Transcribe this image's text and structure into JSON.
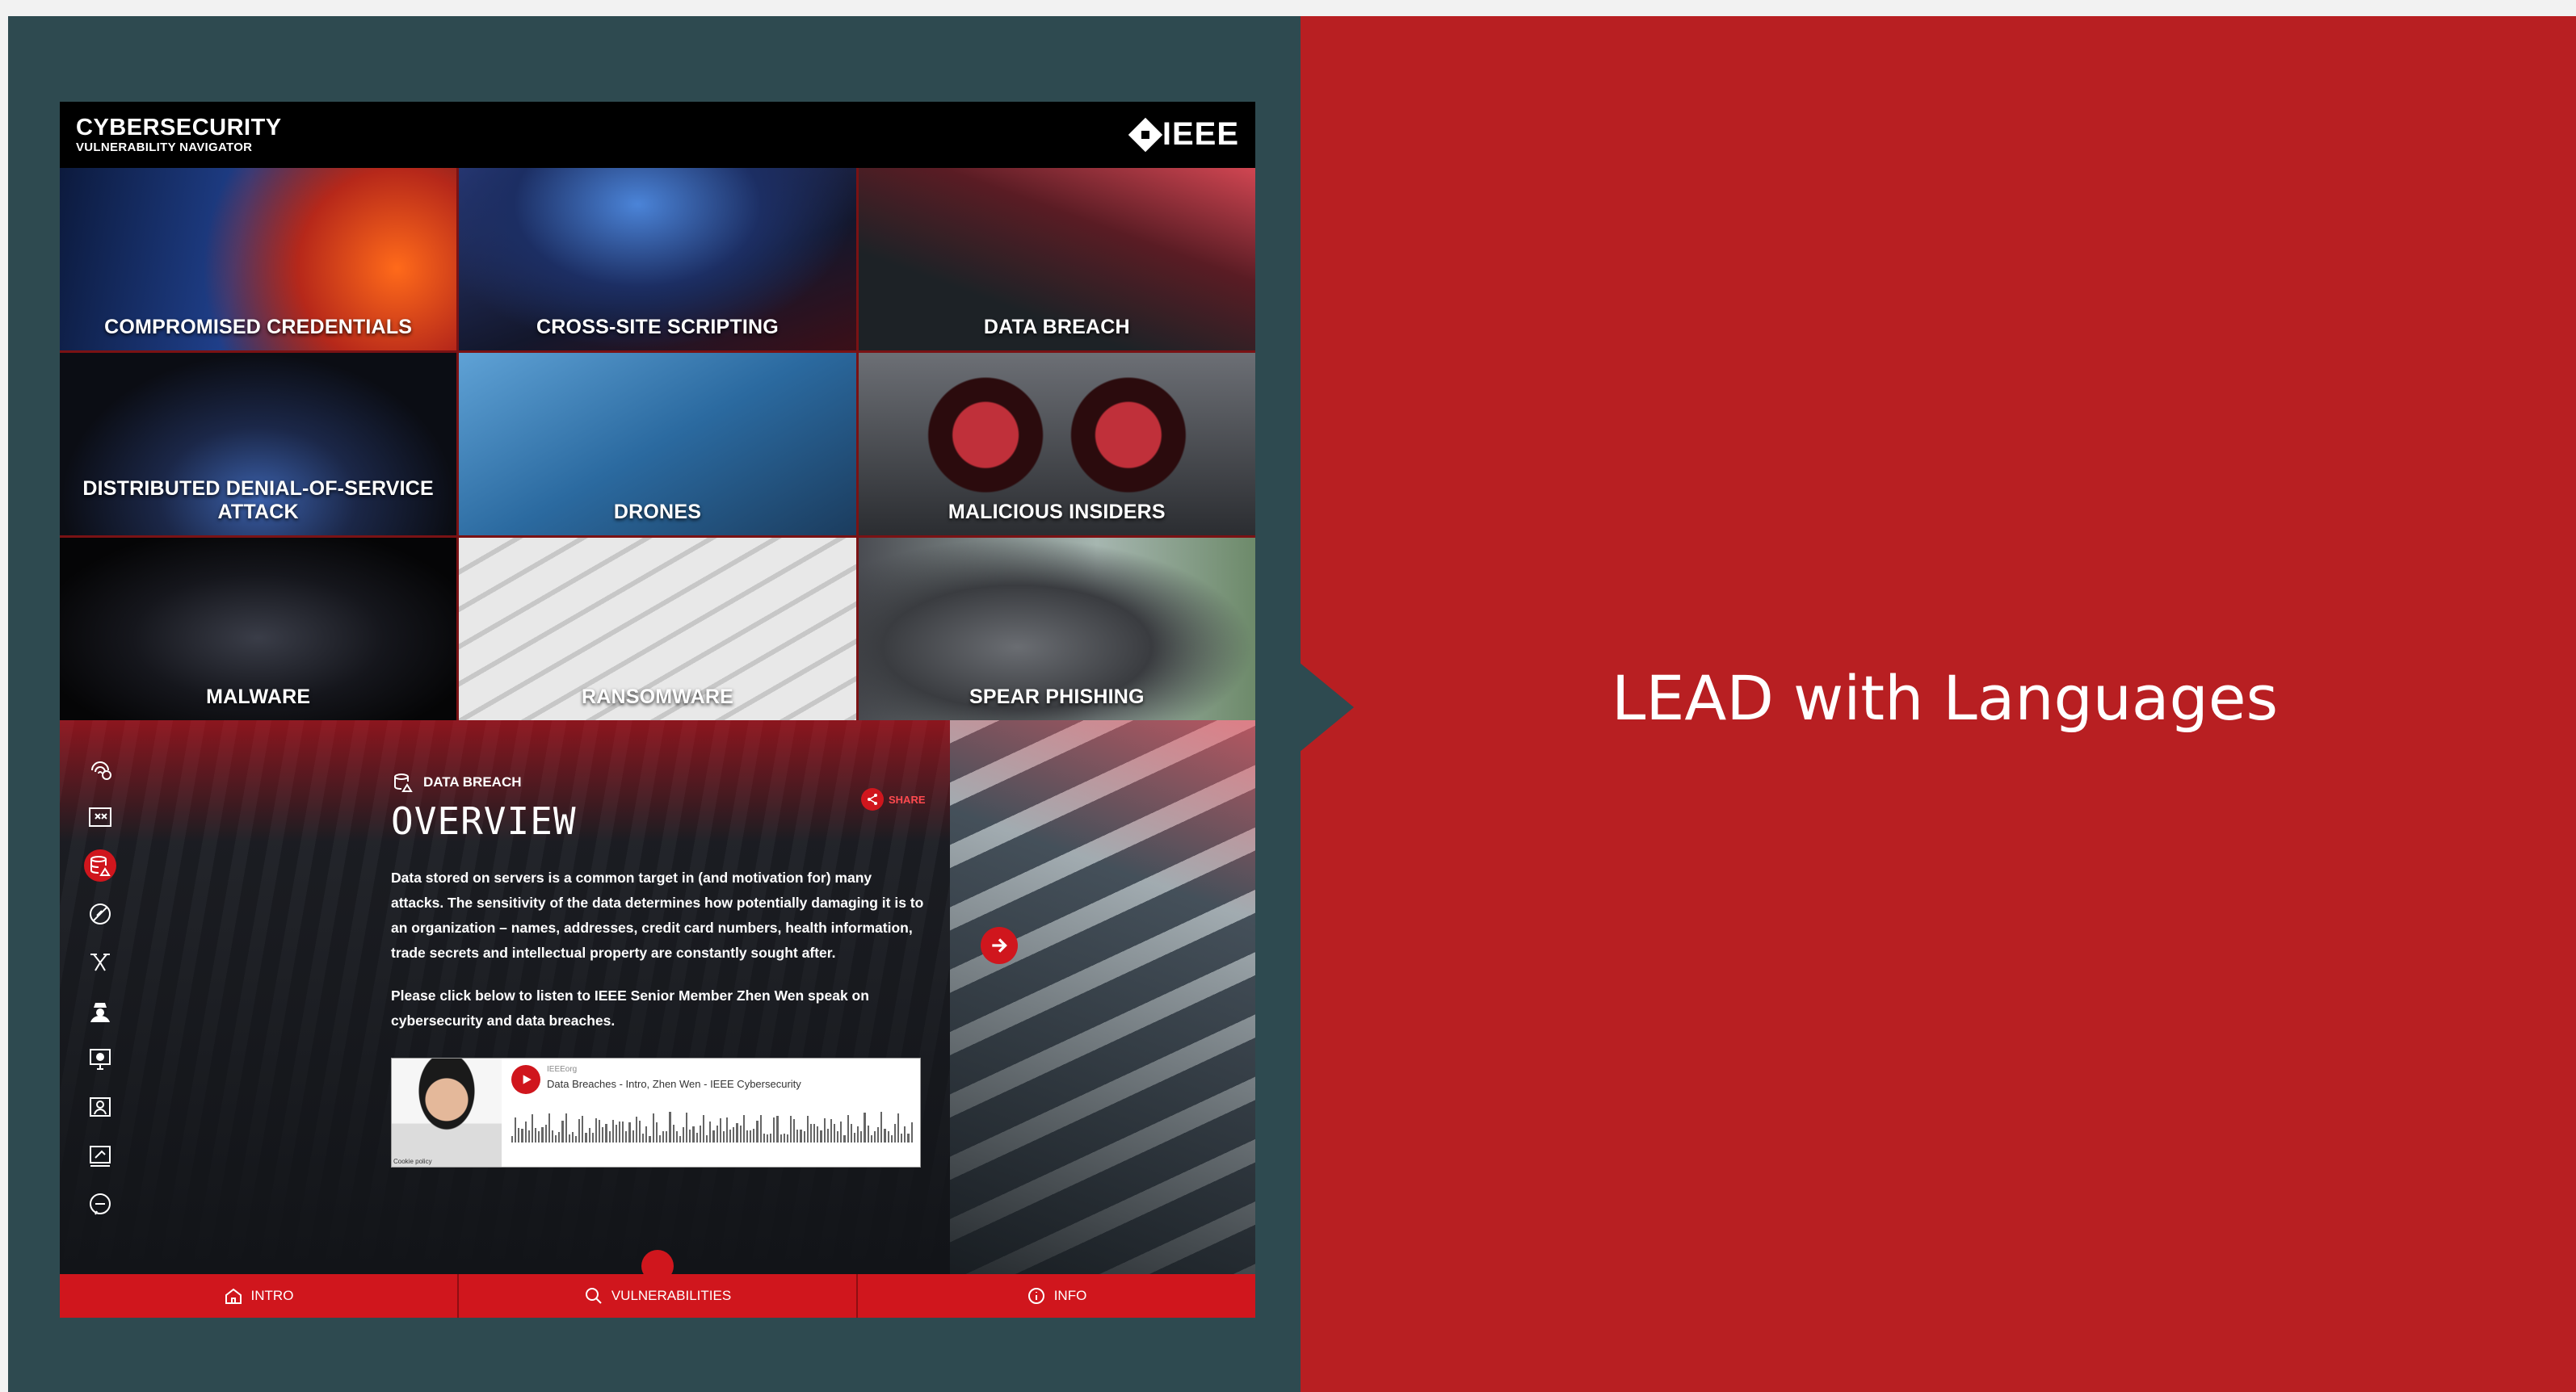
{
  "promo": {
    "title": "LEAD with Languages"
  },
  "app": {
    "brand_title": "CYBERSECURITY",
    "brand_subtitle": "VULNERABILITY NAVIGATOR",
    "logo_text": "IEEE"
  },
  "tiles": [
    {
      "label": "COMPROMISED CREDENTIALS"
    },
    {
      "label": "CROSS-SITE SCRIPTING"
    },
    {
      "label": "DATA BREACH"
    },
    {
      "label": "DISTRIBUTED DENIAL-OF-SERVICE ATTACK"
    },
    {
      "label": "DRONES"
    },
    {
      "label": "MALICIOUS INSIDERS"
    },
    {
      "label": "MALWARE"
    },
    {
      "label": "RANSOMWARE"
    },
    {
      "label": "SPEAR PHISHING"
    }
  ],
  "detail": {
    "section": "DATA BREACH",
    "heading": "OVERVIEW",
    "share_label": "SHARE",
    "paragraph1": "Data stored on servers is a common target in (and motivation for) many attacks. The sensitivity of the data determines how potentially damaging it is to an organization – names, addresses, credit card numbers, health information, trade secrets and intellectual property are constantly sought after.",
    "paragraph2": "Please click below to listen to IEEE Senior Member Zhen Wen speak on cybersecurity and data breaches."
  },
  "player": {
    "uploader": "IEEEorg",
    "track": "Data Breaches - Intro, Zhen Wen - IEEE Cybersecurity",
    "cookie": "Cookie policy"
  },
  "side_icons": [
    {
      "icon": "fingerprint-icon"
    },
    {
      "icon": "code-window-icon"
    },
    {
      "icon": "database-icon",
      "active": true
    },
    {
      "icon": "blocked-icon"
    },
    {
      "icon": "drone-icon"
    },
    {
      "icon": "insider-icon"
    },
    {
      "icon": "malware-icon"
    },
    {
      "icon": "ransomware-icon"
    },
    {
      "icon": "phishing-icon"
    },
    {
      "icon": "chat-icon"
    }
  ],
  "bottom_nav": [
    {
      "label": "INTRO",
      "icon": "home-icon"
    },
    {
      "label": "VULNERABILITIES",
      "icon": "search-icon"
    },
    {
      "label": "INFO",
      "icon": "info-icon"
    }
  ],
  "colors": {
    "red": "#d0161d",
    "panel": "#2e4a50",
    "promo": "#b81f22"
  }
}
